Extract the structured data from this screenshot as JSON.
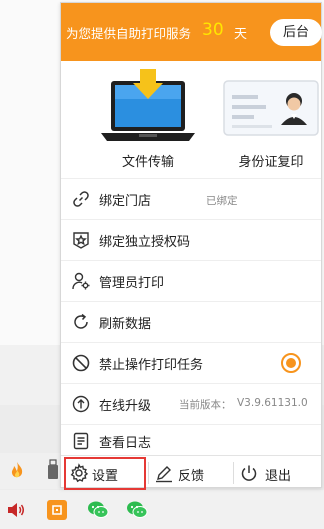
{
  "header": {
    "service_text": "为您提供自助打印服务",
    "days_value": "30",
    "days_unit": "天",
    "backend_button": "后台",
    "accent_color": "#f7941d",
    "days_color": "#ffe600"
  },
  "features": [
    {
      "label": "文件传输",
      "icon": "laptop-upload-icon"
    },
    {
      "label": "身份证复印",
      "icon": "id-card-icon"
    }
  ],
  "menu": {
    "bind_store": {
      "label": "绑定门店",
      "status": "已绑定",
      "icon": "link-icon"
    },
    "bind_license": {
      "label": "绑定独立授权码",
      "icon": "star-badge-icon"
    },
    "admin_print": {
      "label": "管理员打印",
      "icon": "user-gear-icon"
    },
    "refresh": {
      "label": "刷新数据",
      "icon": "refresh-icon"
    },
    "forbid_print": {
      "label": "禁止操作打印任务",
      "icon": "prohibit-icon",
      "toggle_on": true
    },
    "upgrade": {
      "label": "在线升级",
      "version_label": "当前版本：",
      "version": "V3.9.61131.0",
      "icon": "upgrade-icon"
    },
    "logs": {
      "label": "查看日志",
      "icon": "log-icon"
    }
  },
  "footer": {
    "settings": "设置",
    "feedback": "反馈",
    "exit": "退出"
  },
  "taskbar": {
    "tray_icons": [
      "flame-app-icon",
      "usb-icon",
      "speaker-icon",
      "printer-app-icon",
      "wechat-icon",
      "wechat-icon"
    ]
  }
}
